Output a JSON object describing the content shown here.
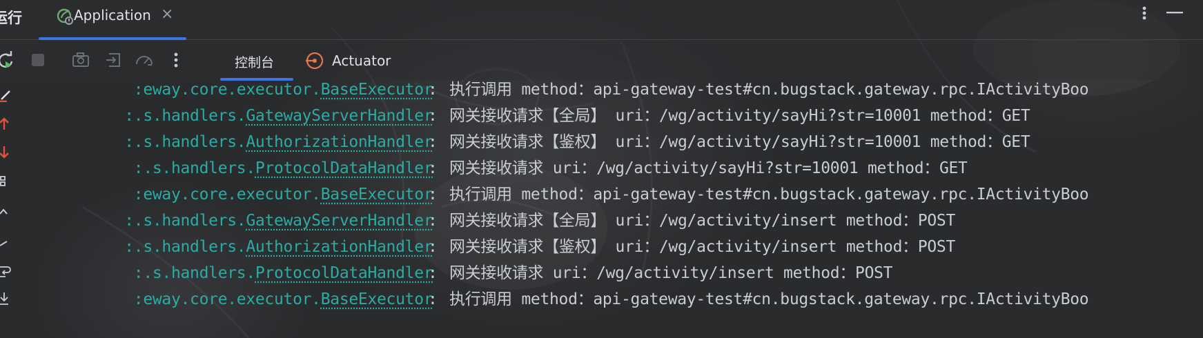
{
  "titlebar": {
    "panel_label": "运行",
    "tab": {
      "icon": "spring-boot-icon",
      "title": "Application",
      "close": "×"
    },
    "more_icon": "vertical-dots-icon",
    "minimize_icon": "minimize-icon"
  },
  "toolbar": {
    "icons": [
      "rerun-icon",
      "stop-icon",
      "camera-icon",
      "exit-icon",
      "dashboard-gauge-icon",
      "more-vertical-icon"
    ],
    "subtabs": [
      {
        "label": "控制台",
        "selected": true
      },
      {
        "label": "Actuator",
        "icon": "actuator-icon",
        "selected": false
      }
    ]
  },
  "gutter": {
    "icons": [
      "edit-icon",
      "up-arrow-icon",
      "down-arrow-icon",
      "grid-icon",
      "chevron-up-icon",
      "slash-icon",
      "wrap-icon",
      "scroll-end-icon"
    ]
  },
  "console": {
    "lines": [
      {
        "pkg": ":eway.core.executor.",
        "cls": "BaseExecutor",
        "colon": ":",
        "message": "执行调用 method：api-gateway-test#cn.bugstack.gateway.rpc.IActivityBoo"
      },
      {
        "pkg": ":.s.handlers.",
        "cls": "GatewayServerHandler",
        "colon": ":",
        "message": "网关接收请求【全局】 uri：/wg/activity/sayHi?str=10001 method：GET"
      },
      {
        "pkg": ":.s.handlers.",
        "cls": "AuthorizationHandler",
        "colon": ":",
        "message": "网关接收请求【鉴权】 uri：/wg/activity/sayHi?str=10001 method：GET"
      },
      {
        "pkg": ":.s.handlers.",
        "cls": "ProtocolDataHandler",
        "colon": ":",
        "message": "网关接收请求 uri：/wg/activity/sayHi?str=10001 method：GET"
      },
      {
        "pkg": ":eway.core.executor.",
        "cls": "BaseExecutor",
        "colon": ":",
        "message": "执行调用 method：api-gateway-test#cn.bugstack.gateway.rpc.IActivityBoo"
      },
      {
        "pkg": ":.s.handlers.",
        "cls": "GatewayServerHandler",
        "colon": ":",
        "message": "网关接收请求【全局】 uri：/wg/activity/insert method：POST"
      },
      {
        "pkg": ":.s.handlers.",
        "cls": "AuthorizationHandler",
        "colon": ":",
        "message": "网关接收请求【鉴权】 uri：/wg/activity/insert method：POST"
      },
      {
        "pkg": ":.s.handlers.",
        "cls": "ProtocolDataHandler",
        "colon": ":",
        "message": "网关接收请求 uri：/wg/activity/insert method：POST"
      },
      {
        "pkg": ":eway.core.executor.",
        "cls": "BaseExecutor",
        "colon": ":",
        "message": "执行调用 method：api-gateway-test#cn.bugstack.gateway.rpc.IActivityBoo"
      }
    ]
  },
  "colors": {
    "logger": "#2aaca4",
    "text": "#c9ccd1",
    "accent": "#3d74e8",
    "actuator": "#e8784a",
    "gutter_arrows": "#e0553a"
  }
}
